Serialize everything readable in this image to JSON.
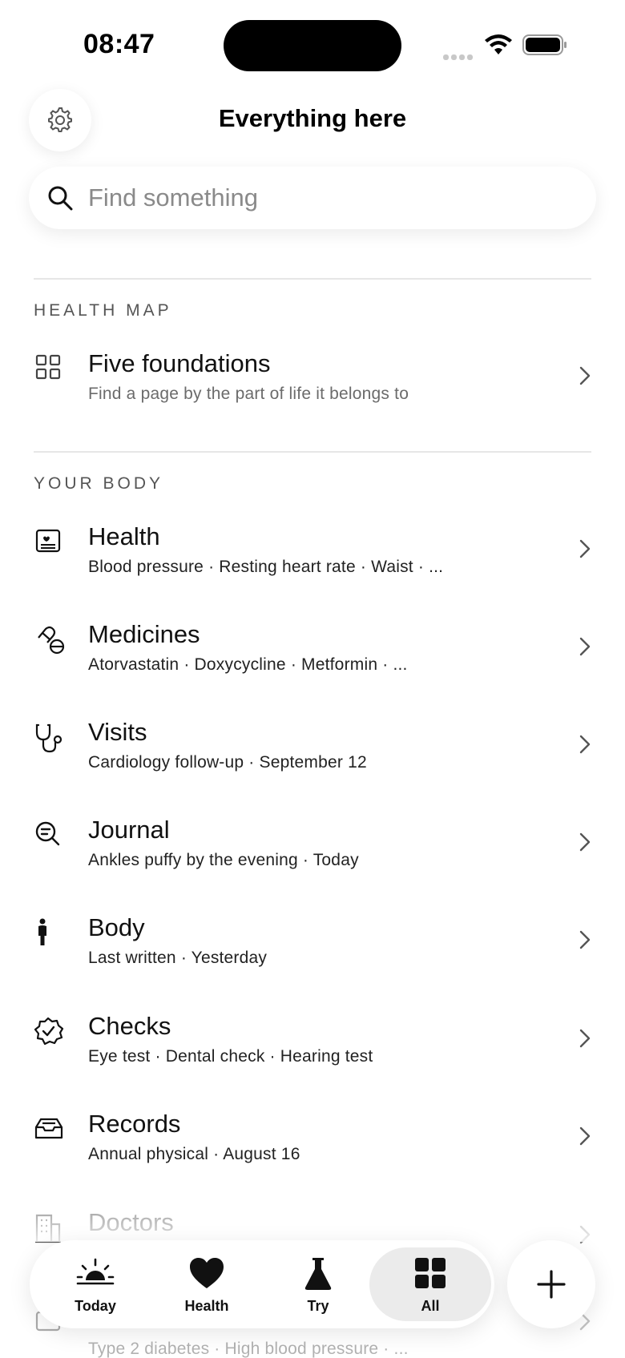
{
  "status_bar": {
    "time": "08:47"
  },
  "header": {
    "title": "Everything here",
    "settings_icon": "gear-icon"
  },
  "search": {
    "placeholder": "Find something",
    "value": ""
  },
  "sections": [
    {
      "label": "HEALTH MAP",
      "items": [
        {
          "title": "Five foundations",
          "subtitle": "Find a page by the part of life it belongs to",
          "icon": "grid-icon"
        }
      ]
    },
    {
      "label": "YOUR BODY",
      "items": [
        {
          "title": "Health",
          "subtitle": "Blood pressure · Resting heart rate · Waist · ...",
          "icon": "id-card-heart-icon"
        },
        {
          "title": "Medicines",
          "subtitle": "Atorvastatin · Doxycycline · Metformin · ...",
          "icon": "pill-icon"
        },
        {
          "title": "Visits",
          "subtitle": "Cardiology follow-up · September 12",
          "icon": "stethoscope-icon"
        },
        {
          "title": "Journal",
          "subtitle": "Ankles puffy by the evening · Today",
          "icon": "search-text-icon"
        },
        {
          "title": "Body",
          "subtitle": "Last written · Yesterday",
          "icon": "person-icon"
        },
        {
          "title": "Checks",
          "subtitle": "Eye test · Dental check · Hearing test",
          "icon": "badge-check-icon"
        },
        {
          "title": "Records",
          "subtitle": "Annual physical · August 16",
          "icon": "inbox-tray-icon"
        },
        {
          "title": "Doctors",
          "subtitle": "",
          "icon": "building-icon"
        },
        {
          "title": "",
          "subtitle": "Type 2 diabetes · High blood pressure · ...",
          "icon": "id-card-icon"
        }
      ]
    }
  ],
  "tabbar": {
    "tabs": [
      {
        "label": "Today",
        "icon": "sunrise-icon"
      },
      {
        "label": "Health",
        "icon": "heart-icon"
      },
      {
        "label": "Try",
        "icon": "flask-icon"
      },
      {
        "label": "All",
        "icon": "grid-filled-icon",
        "active": true
      }
    ],
    "add_icon": "plus-icon"
  }
}
